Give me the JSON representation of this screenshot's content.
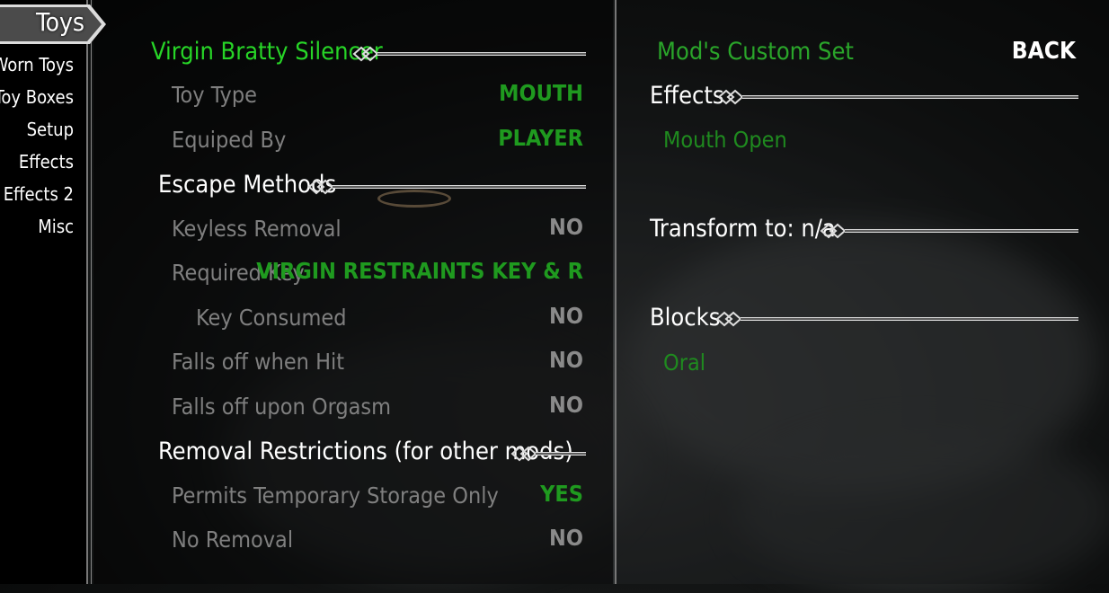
{
  "tab": {
    "label": "Toys"
  },
  "nav": [
    "Worn Toys",
    "Toy Boxes",
    "Setup",
    "Effects",
    "Effects 2",
    "Misc"
  ],
  "left": {
    "title": "Virgin Bratty Silencer",
    "toy_type": {
      "label": "Toy Type",
      "value": "MOUTH"
    },
    "equiped_by": {
      "label": "Equiped By",
      "value": "PLAYER"
    },
    "escape_header": "Escape Methods",
    "keyless": {
      "label": "Keyless Removal",
      "value": "NO"
    },
    "required_key": {
      "label": "Required Key",
      "value": "VIRGIN RESTRAINTS KEY & R"
    },
    "key_consumed": {
      "label": "Key Consumed",
      "value": "NO"
    },
    "falls_hit": {
      "label": "Falls off when Hit",
      "value": "NO"
    },
    "falls_orgasm": {
      "label": "Falls off upon Orgasm",
      "value": "NO"
    },
    "removal_header": "Removal Restrictions (for other mods)",
    "temp_storage": {
      "label": "Permits Temporary Storage Only",
      "value": "YES"
    },
    "no_removal": {
      "label": "No Removal",
      "value": "NO"
    }
  },
  "right": {
    "custom_set": "Mod's Custom Set",
    "back": "BACK",
    "effects_header": "Effects",
    "effect_item": "Mouth Open",
    "transform_header": "Transform to: n/a",
    "blocks_header": "Blocks",
    "block_item": "Oral"
  },
  "colors": {
    "accent_green": "#27d527",
    "value_green": "#1f9a1f",
    "label_grey": "#7f7f7f"
  }
}
